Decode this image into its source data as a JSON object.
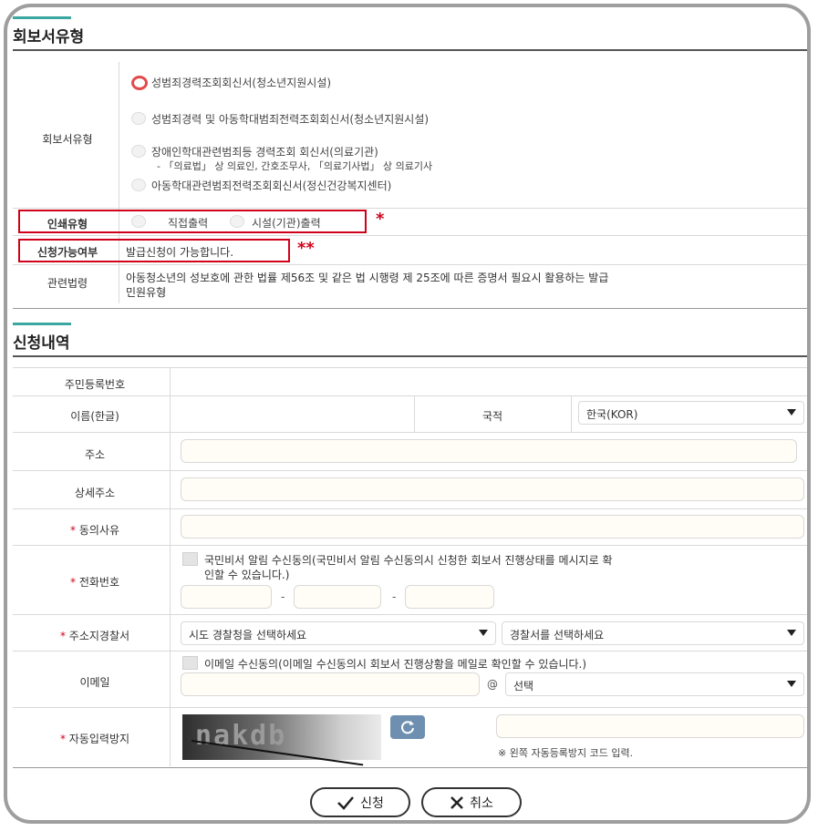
{
  "report_section": {
    "title": "회보서유형",
    "type_label": "회보서유형",
    "options": [
      "성범죄경력조회회신서(청소년지원시설)",
      "성범죄경력 및 아동학대범죄전력조회회신서(청소년지원시설)",
      "장애인학대관련범죄등 경력조회 회신서(의료기관)",
      "아동학대관련범죄전력조회회신서(정신건강복지센터)"
    ],
    "option3_sub": "- 「의료법」 상 의료인, 간호조무사, 「의료기사법」 상 의료기사",
    "print_label": "인쇄유형",
    "print_options": [
      "직접출력",
      "시설(기관)출력"
    ],
    "print_mark": "*",
    "avail_label": "신청가능여부",
    "avail_value": "발급신청이 가능합니다.",
    "avail_mark": "**",
    "law_label": "관련법령",
    "law_text_1": "아동청소년의 성보호에 관한 법률 제56조 및 같은 법 시행령 제 25조에 따른 증명서 필요시 활용하는 발급",
    "law_text_2": "민원유형"
  },
  "apply_section": {
    "title": "신청내역",
    "rrn_label": "주민등록번호",
    "name_label": "이름(한글)",
    "nationality_label": "국적",
    "nationality_value": "한국(KOR)",
    "address_label": "주소",
    "detail_address_label": "상세주소",
    "consent_reason_label": "동의사유",
    "phone_label": "전화번호",
    "phone_consent_1": "국민비서 알림 수신동의(국민비서 알림 수신동의시 신청한 회보서 진행상태를 메시지로 확",
    "phone_consent_2": "인할 수 있습니다.)",
    "phone_sep": "-",
    "police_label": "주소지경찰서",
    "police_agency_placeholder": "시도 경찰청을 선택하세요",
    "police_station_placeholder": "경찰서를 선택하세요",
    "email_label": "이메일",
    "email_consent": "이메일 수신동의(이메일 수신동의시 회보서 진행상황을 메일로 확인할 수 있습니다.)",
    "email_at": "@",
    "email_domain": "선택",
    "captcha_label": "자동입력방지",
    "captcha_text": "nakdb",
    "captcha_hint": "※ 왼쪽 자동등록방지 코드 입력.",
    "required_mark": "*"
  },
  "buttons": {
    "submit": "신청",
    "cancel": "취소"
  },
  "colors": {
    "accent": "#3aa7a0",
    "required": "#d0021b",
    "highlight_box": "#d0021b"
  }
}
